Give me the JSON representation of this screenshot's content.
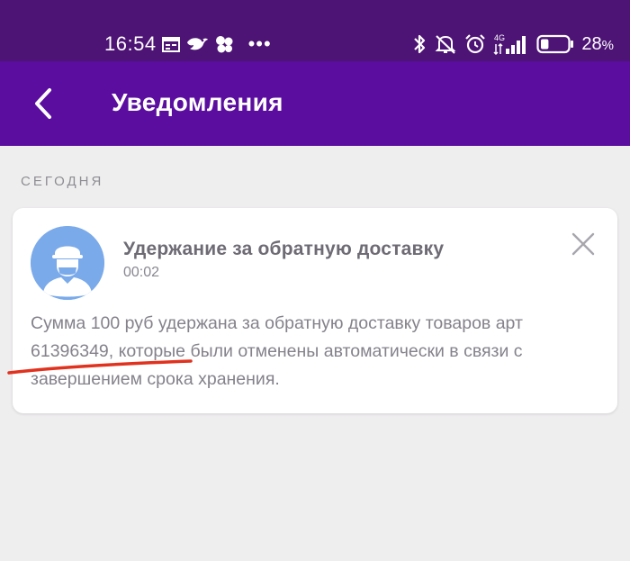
{
  "status_bar": {
    "time": "16:54",
    "network": "4G",
    "battery_percent": "28",
    "battery_symbol": "%",
    "battery_level": 0.28,
    "icons": [
      "calendar-icon",
      "bird-icon",
      "clover-icon",
      "more-dots-icon",
      "bluetooth-icon",
      "mute-icon",
      "alarm-icon",
      "signal-icon",
      "battery-icon"
    ],
    "dots": "•••"
  },
  "app_bar": {
    "title": "Уведомления",
    "background": "#5a0d9e"
  },
  "section": {
    "label": "СЕГОДНЯ"
  },
  "notification": {
    "title": "Удержание за обратную доставку",
    "time": "00:02",
    "body_line_1": "Сумма 100 руб удержана за обратную доставку товаров арт",
    "body_line_2": "61396349, которые были отменены автоматически в связи с",
    "body_line_3": "завершением срока хранения.",
    "avatar_color": "#7aaaea"
  },
  "annotation": {
    "color": "#e0321e"
  }
}
